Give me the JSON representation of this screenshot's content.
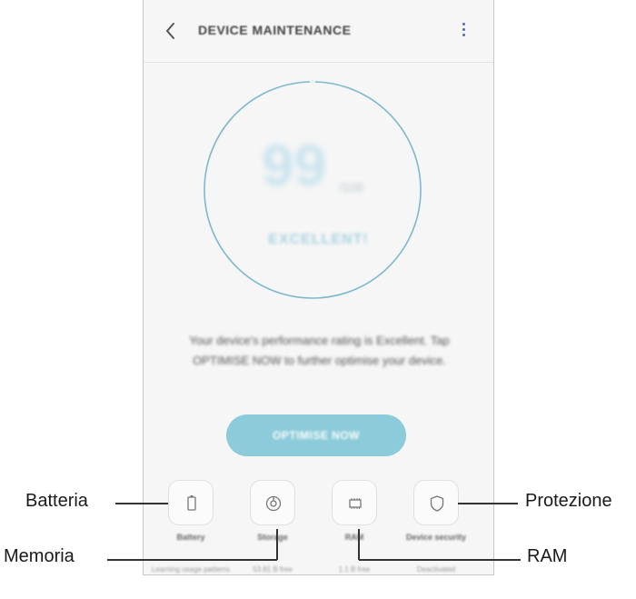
{
  "header": {
    "title": "DEVICE MAINTENANCE",
    "back_icon": "chevron-left-icon",
    "menu_icon": "more-vert-icon"
  },
  "gauge": {
    "score": "99",
    "unit": "/100",
    "rating": "EXCELLENT!",
    "ring_color": "#7db9ce"
  },
  "description": "Your device's performance rating is Excellent. Tap OPTIMISE NOW to further optimise your device.",
  "optimise_button": {
    "label": "OPTIMISE NOW",
    "color": "#8ccbd9"
  },
  "tiles": [
    {
      "key": "battery",
      "label": "Battery",
      "sub": "Learning usage patterns",
      "icon": "battery-icon"
    },
    {
      "key": "storage",
      "label": "Storage",
      "sub": "53.81 B free",
      "icon": "storage-icon"
    },
    {
      "key": "ram",
      "label": "RAM",
      "sub": "1.1 B free",
      "icon": "chip-icon"
    },
    {
      "key": "security",
      "label": "Device security",
      "sub": "Deactivated",
      "icon": "shield-icon"
    }
  ],
  "callouts": {
    "batteria": "Batteria",
    "memoria": "Memoria",
    "ram": "RAM",
    "protezione": "Protezione"
  }
}
